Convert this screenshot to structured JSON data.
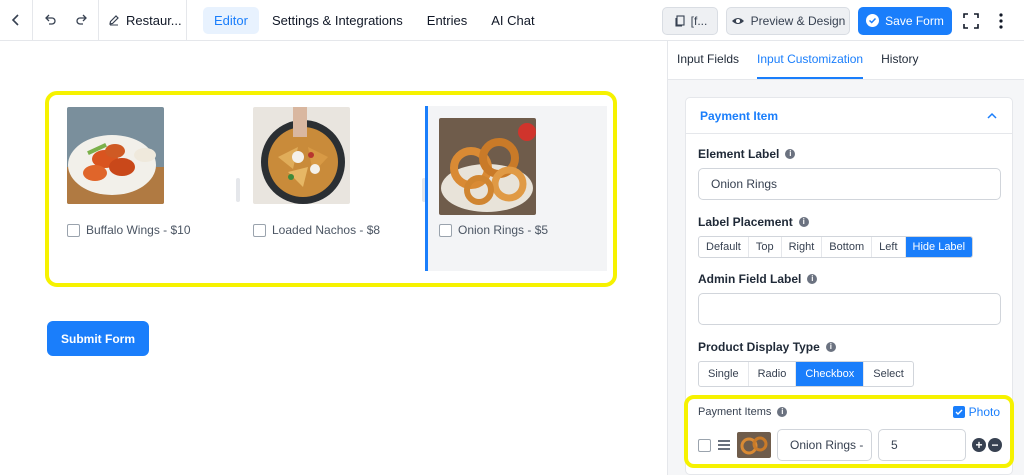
{
  "topbar": {
    "form_title": "Restaur...",
    "tabs": [
      {
        "label": "Editor",
        "active": true
      },
      {
        "label": "Settings & Integrations",
        "active": false
      },
      {
        "label": "Entries",
        "active": false
      },
      {
        "label": "AI Chat",
        "active": false
      }
    ],
    "shortcode_label": "[f...",
    "preview_label": "Preview & Design",
    "save_label": "Save Form"
  },
  "canvas": {
    "items": [
      {
        "label": "Buffalo Wings - $10",
        "icon": "buffalo-wings-image"
      },
      {
        "label": "Loaded Nachos - $8",
        "icon": "loaded-nachos-image"
      },
      {
        "label": "Onion Rings - $5",
        "icon": "onion-rings-image",
        "selected": true
      }
    ],
    "submit_label": "Submit Form"
  },
  "panel": {
    "tabs": [
      {
        "label": "Input Fields",
        "active": false
      },
      {
        "label": "Input Customization",
        "active": true
      },
      {
        "label": "History",
        "active": false
      }
    ],
    "section_title": "Payment Item",
    "element_label": {
      "label": "Element Label",
      "value": "Onion Rings"
    },
    "label_placement": {
      "label": "Label Placement",
      "options": [
        "Default",
        "Top",
        "Right",
        "Bottom",
        "Left",
        "Hide Label"
      ],
      "selected": "Hide Label"
    },
    "admin_field_label": {
      "label": "Admin Field Label",
      "value": ""
    },
    "product_display_type": {
      "label": "Product Display Type",
      "options": [
        "Single",
        "Radio",
        "Checkbox",
        "Select"
      ],
      "selected": "Checkbox"
    },
    "payment_items": {
      "label": "Payment Items",
      "photo_label": "Photo",
      "row": {
        "name": "Onion Rings -",
        "price": "5"
      }
    }
  },
  "colors": {
    "accent": "#1a7efb",
    "highlight": "#f6f200"
  }
}
